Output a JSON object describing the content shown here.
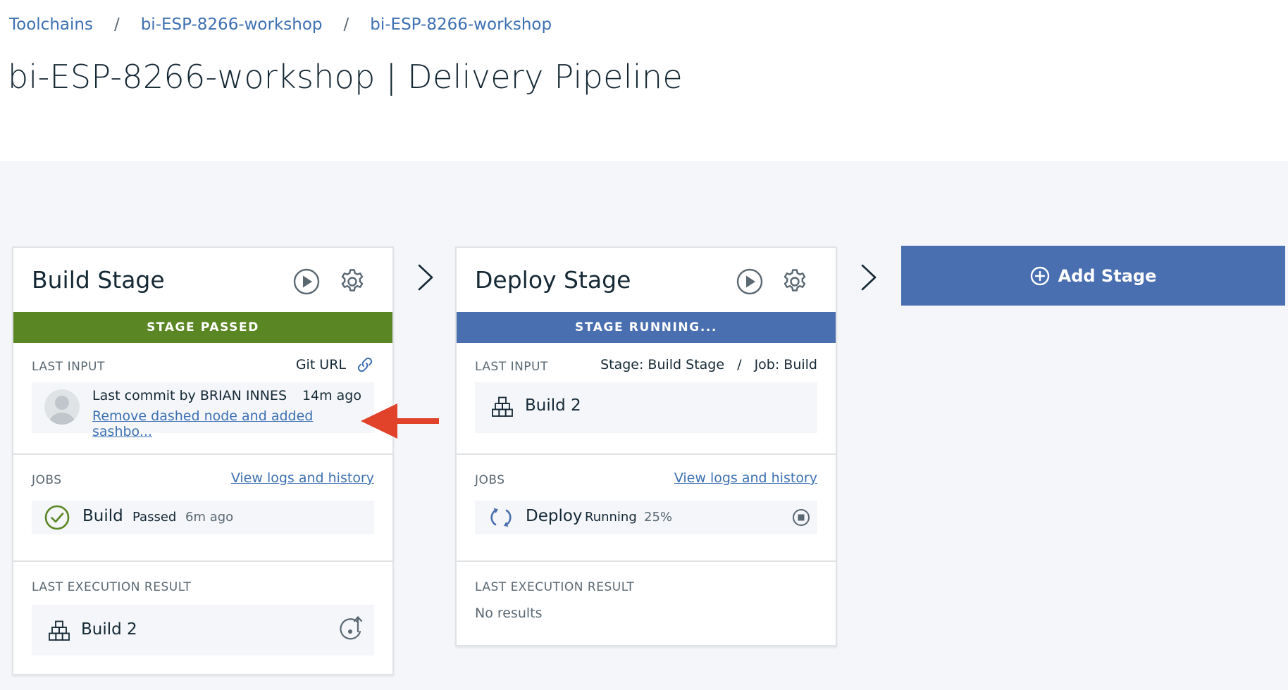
{
  "breadcrumb": [
    {
      "label": "Toolchains"
    },
    {
      "label": "bi-ESP-8266-workshop"
    },
    {
      "label": "bi-ESP-8266-workshop"
    }
  ],
  "breadcrumb_separator": "/",
  "page_title": "bi-ESP-8266-workshop | Delivery Pipeline",
  "colors": {
    "passed": "#5a8623",
    "running": "#4a6fb0",
    "link": "#3d70b2",
    "accent_arrow": "#e0432a"
  },
  "build_stage": {
    "name": "Build Stage",
    "status": "STAGE PASSED",
    "last_input_label": "LAST INPUT",
    "git_url_label": "Git URL",
    "commit_text": "Last commit by BRIAN INNES",
    "commit_time": "14m ago",
    "commit_message": "Remove dashed node and added sashbo...",
    "jobs_label": "JOBS",
    "view_logs": "View logs and history",
    "job": {
      "name": "Build",
      "status": "Passed",
      "time": "6m ago"
    },
    "last_exec_label": "LAST EXECUTION RESULT",
    "last_exec_result": "Build 2"
  },
  "deploy_stage": {
    "name": "Deploy Stage",
    "status": "STAGE RUNNING...",
    "last_input_label": "LAST INPUT",
    "input_source_stage": "Stage: Build Stage",
    "input_sep": "/",
    "input_source_job": "Job: Build",
    "input_build": "Build 2",
    "jobs_label": "JOBS",
    "view_logs": "View logs and history",
    "job": {
      "name": "Deploy",
      "status": "Running",
      "progress": "25%"
    },
    "last_exec_label": "LAST EXECUTION RESULT",
    "last_exec_result": "No results"
  },
  "add_stage_label": "Add Stage"
}
